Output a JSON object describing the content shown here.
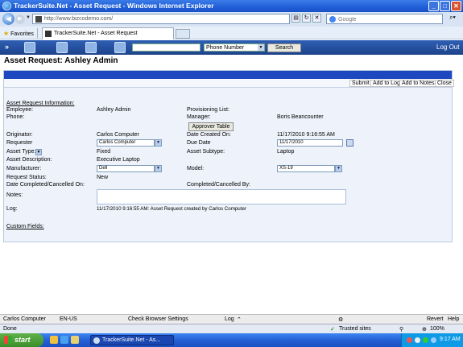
{
  "browser": {
    "window_title": "TrackerSuite.Net - Asset Request - Windows Internet Explorer",
    "url": "http://www.bizcodemo.com/",
    "search_placeholder": "Google",
    "favorites_label": "Favorites",
    "tab_title": "TrackerSuite.Net - Asset Request"
  },
  "app_toolbar": {
    "search_value": "",
    "search_type": "Phone Number",
    "search_button": "Search",
    "logout": "Log Out"
  },
  "page": {
    "title": "Asset Request: Ashley Admin"
  },
  "actions": {
    "submit": "Submit",
    "add_to_log": "Add to Log",
    "add_to_notes": "Add to Notes",
    "close": "Close"
  },
  "form": {
    "section_title": "Asset Request Information:",
    "employee_label": "Employee:",
    "employee_value": "Ashley Admin",
    "provisioning_label": "Provisioning List:",
    "phone_label": "Phone:",
    "manager_label": "Manager:",
    "manager_value": "Boris Beancounter",
    "approver_button": "Approver Table",
    "originator_label": "Originator:",
    "originator_value": "Carlos Computer",
    "date_created_label": "Date Created On:",
    "date_created_value": "11/17/2010 9:16:55 AM",
    "requester_label": "Requester",
    "requester_value": "Carlos Computer",
    "due_date_label": "Due Date",
    "due_date_value": "11/17/2010",
    "asset_type_label": "Asset Type:",
    "asset_type_value": "Fixed",
    "asset_subtype_label": "Asset Subtype:",
    "asset_subtype_value": "Laptop",
    "asset_desc_label": "Asset Description:",
    "asset_desc_value": "Executive Laptop",
    "manufacturer_label": "Manufacturer:",
    "manufacturer_value": "Dell",
    "model_label": "Model:",
    "model_value": "XS-19",
    "status_label": "Request Status:",
    "status_value": "New",
    "date_completed_label": "Date Completed/Cancelled On:",
    "completed_by_label": "Completed/Cancelled By:",
    "notes_label": "Notes:",
    "log_label": "Log:",
    "log_value": "11/17/2010 9:16:55 AM: Asset Request created by Carlos Computer",
    "custom_fields_label": "Custom Fields:"
  },
  "app_status": {
    "user": "Carlos Computer",
    "locale": "EN-US",
    "check_browser": "Check Browser Settings",
    "log": "Log",
    "revert": "Revert",
    "help": "Help"
  },
  "ie_status": {
    "status": "Done",
    "zone": "Trusted sites",
    "zoom": "100%"
  },
  "taskbar": {
    "start": "start",
    "task_item": "TrackerSuite.Net - As...",
    "clock": "9:17 AM"
  }
}
